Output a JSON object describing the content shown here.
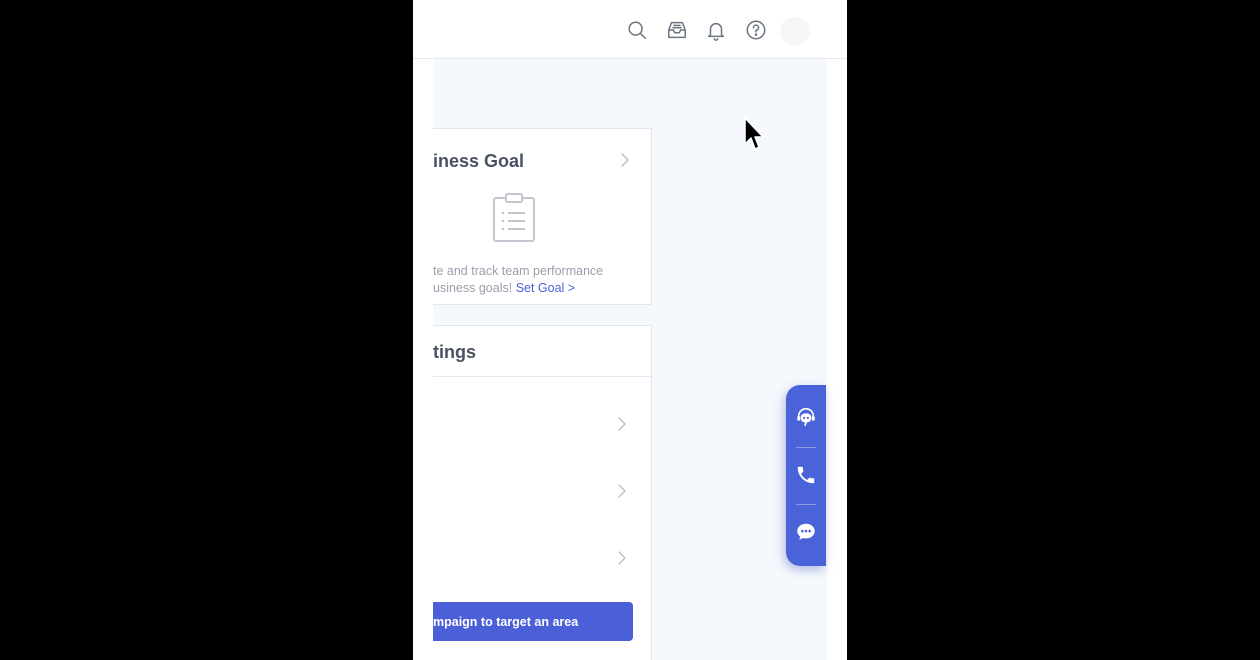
{
  "topbar": {
    "icons": [
      "search-icon",
      "inbox-icon",
      "bell-icon",
      "help-icon"
    ]
  },
  "goal_card": {
    "title": "iness Goal",
    "line1": "te and track team performance",
    "line2": "usiness goals! ",
    "link": "Set Goal >"
  },
  "settings_card": {
    "title": "tings",
    "button_label": "mpaign to target an area"
  },
  "fab": {
    "icons": [
      "support-bot-icon",
      "phone-icon",
      "chat-icon"
    ]
  },
  "colors": {
    "accent": "#4b63d9",
    "page_bg": "#f5f8fc",
    "title_text": "#4a5162",
    "muted_text": "#9aa0ac"
  }
}
